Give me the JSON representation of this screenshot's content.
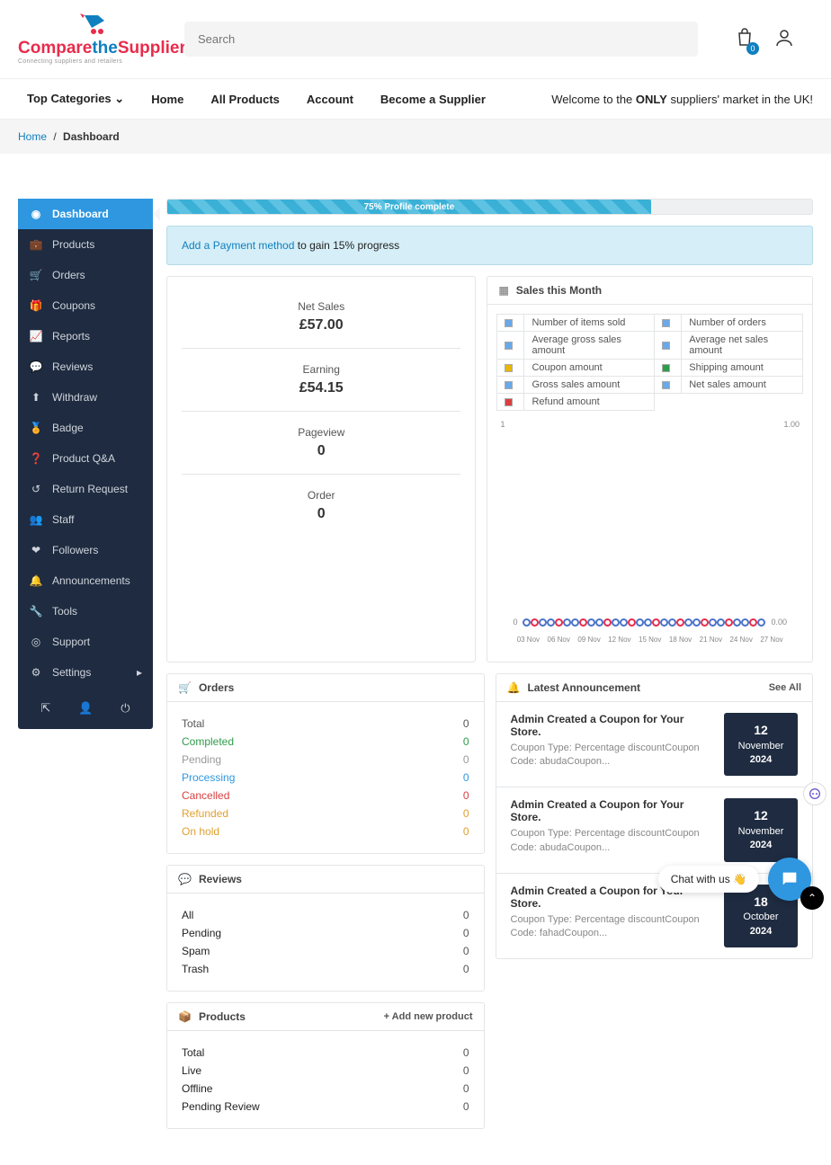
{
  "header": {
    "search_placeholder": "Search",
    "bag_count": "0",
    "logo_line1a": "Compare",
    "logo_line1b": "the",
    "logo_line1c": "Suppliers",
    "logo_line2": "Connecting suppliers and retailers"
  },
  "nav": {
    "top_categories": "Top Categories",
    "items": [
      "Home",
      "All Products",
      "Account",
      "Become a Supplier"
    ],
    "tagline_prefix": "Welcome to the ",
    "tagline_bold": "ONLY",
    "tagline_suffix": " suppliers' market in the UK!"
  },
  "breadcrumb": {
    "home": "Home",
    "current": "Dashboard"
  },
  "sidebar": {
    "items": [
      {
        "label": "Dashboard",
        "active": true
      },
      {
        "label": "Products"
      },
      {
        "label": "Orders"
      },
      {
        "label": "Coupons"
      },
      {
        "label": "Reports"
      },
      {
        "label": "Reviews"
      },
      {
        "label": "Withdraw"
      },
      {
        "label": "Badge"
      },
      {
        "label": "Product Q&A"
      },
      {
        "label": "Return Request"
      },
      {
        "label": "Staff"
      },
      {
        "label": "Followers"
      },
      {
        "label": "Announcements"
      },
      {
        "label": "Tools"
      },
      {
        "label": "Support"
      },
      {
        "label": "Settings"
      }
    ]
  },
  "progress": {
    "text": "75% Profile complete",
    "pct": 75
  },
  "notice": {
    "link": "Add a Payment method",
    "rest": " to gain 15% progress"
  },
  "summary": [
    {
      "label": "Net Sales",
      "value": "£57.00"
    },
    {
      "label": "Earning",
      "value": "£54.15"
    },
    {
      "label": "Pageview",
      "value": "0"
    },
    {
      "label": "Order",
      "value": "0"
    }
  ],
  "chart_data": {
    "type": "line",
    "title": "Sales this Month",
    "legend": [
      {
        "label": "Number of items sold",
        "color": "#6aa8e8"
      },
      {
        "label": "Number of orders",
        "color": "#6aa8e8"
      },
      {
        "label": "Average gross sales amount",
        "color": "#6aa8e8"
      },
      {
        "label": "Average net sales amount",
        "color": "#6aa8e8"
      },
      {
        "label": "Coupon amount",
        "color": "#e6b800"
      },
      {
        "label": "Shipping amount",
        "color": "#2e9c4b"
      },
      {
        "label": "Gross sales amount",
        "color": "#6aa8e8"
      },
      {
        "label": "Net sales amount",
        "color": "#6aa8e8"
      },
      {
        "label": "Refund amount",
        "color": "#d94040"
      }
    ],
    "categories": [
      "03 Nov",
      "06 Nov",
      "09 Nov",
      "12 Nov",
      "15 Nov",
      "18 Nov",
      "21 Nov",
      "24 Nov",
      "27 Nov"
    ],
    "yleft_range": [
      0,
      1
    ],
    "yright_range": [
      0.0,
      1.0
    ],
    "yleft": "1",
    "yright": "1.00",
    "zero_l": "0",
    "zero_r": "0.00",
    "series": [
      {
        "name": "Number of items sold",
        "values": [
          0,
          0,
          0,
          0,
          0,
          0,
          0,
          0,
          0,
          0,
          0,
          0,
          0,
          0,
          0,
          0,
          0,
          0,
          0,
          0,
          0,
          0,
          0,
          0,
          0,
          0,
          0,
          0,
          0,
          0
        ]
      },
      {
        "name": "Number of orders",
        "values": [
          0,
          0,
          0,
          0,
          0,
          0,
          0,
          0,
          0,
          0,
          0,
          0,
          0,
          0,
          0,
          0,
          0,
          0,
          0,
          0,
          0,
          0,
          0,
          0,
          0,
          0,
          0,
          0,
          0,
          0
        ]
      }
    ]
  },
  "orders": {
    "title": "Orders",
    "items": [
      {
        "label": "Total",
        "count": "0",
        "color": "#555"
      },
      {
        "label": "Completed",
        "count": "0",
        "color": "#2e9c4b"
      },
      {
        "label": "Pending",
        "count": "0",
        "color": "#999"
      },
      {
        "label": "Processing",
        "count": "0",
        "color": "#2f97e0"
      },
      {
        "label": "Cancelled",
        "count": "0",
        "color": "#d94040"
      },
      {
        "label": "Refunded",
        "count": "0",
        "color": "#e0a030"
      },
      {
        "label": "On hold",
        "count": "0",
        "color": "#e0a030"
      }
    ]
  },
  "reviews": {
    "title": "Reviews",
    "items": [
      {
        "label": "All",
        "count": "0"
      },
      {
        "label": "Pending",
        "count": "0"
      },
      {
        "label": "Spam",
        "count": "0"
      },
      {
        "label": "Trash",
        "count": "0"
      }
    ]
  },
  "products": {
    "title": "Products",
    "add_link": "+ Add new product",
    "items": [
      {
        "label": "Total",
        "count": "0"
      },
      {
        "label": "Live",
        "count": "0"
      },
      {
        "label": "Offline",
        "count": "0"
      },
      {
        "label": "Pending Review",
        "count": "0"
      }
    ]
  },
  "announcements": {
    "title": "Latest Announcement",
    "see_all": "See All",
    "items": [
      {
        "title": "Admin Created a Coupon for Your Store.",
        "desc": "Coupon Type: Percentage discountCoupon Code: abudaCoupon...",
        "day": "12",
        "month": "November",
        "year": "2024"
      },
      {
        "title": "Admin Created a Coupon for Your Store.",
        "desc": "Coupon Type: Percentage discountCoupon Code: abudaCoupon...",
        "day": "12",
        "month": "November",
        "year": "2024"
      },
      {
        "title": "Admin Created a Coupon for Your Store.",
        "desc": "Coupon Type: Percentage discountCoupon Code: fahadCoupon...",
        "day": "18",
        "month": "October",
        "year": "2024"
      }
    ]
  },
  "chat": {
    "label": "Chat with us 👋"
  }
}
